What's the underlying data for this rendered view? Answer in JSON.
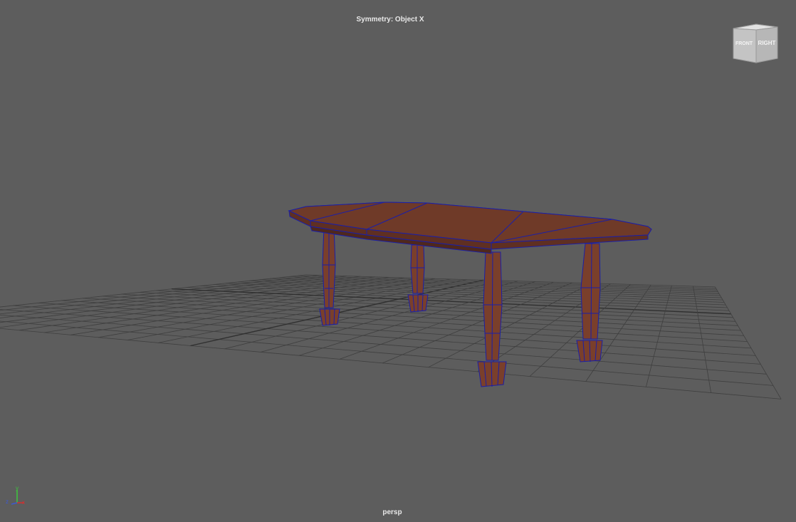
{
  "viewport": {
    "symmetry_label": "Symmetry: Object X",
    "camera_label": "persp"
  },
  "view_cube": {
    "front_label": "FRONT",
    "right_label": "RIGHT"
  },
  "axis_gizmo": {
    "x_label": "x",
    "y_label": "y",
    "z_label": "z",
    "x_color": "#d23030",
    "y_color": "#3cc83c",
    "z_color": "#3c5ad2"
  },
  "colors": {
    "background": "#5d5d5d",
    "grid": "#3f3f3f",
    "grid_axis": "#303030",
    "wood": "#7a3f2b",
    "wood_dark": "#5f2f22",
    "wireframe": "#1a1fa8"
  }
}
